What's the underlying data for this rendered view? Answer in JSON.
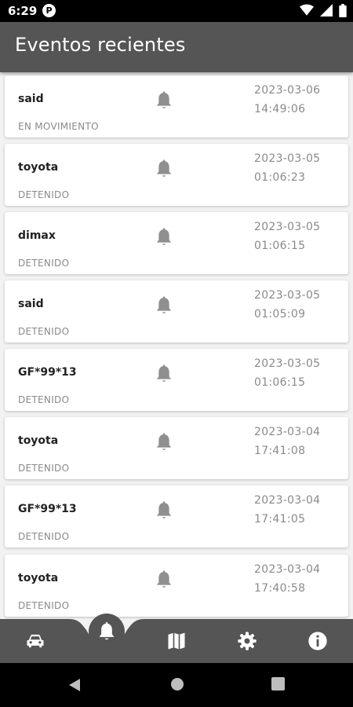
{
  "status_bar": {
    "time": "6:29",
    "app_icon_letter": "P"
  },
  "appbar": {
    "title": "Eventos recientes"
  },
  "events": [
    {
      "name": "said",
      "state": "EN MOVIMIENTO",
      "date": "2023-03-06",
      "time": "14:49:06"
    },
    {
      "name": "toyota",
      "state": "DETENIDO",
      "date": "2023-03-05",
      "time": "01:06:23"
    },
    {
      "name": "dimax",
      "state": "DETENIDO",
      "date": "2023-03-05",
      "time": "01:06:15"
    },
    {
      "name": "said",
      "state": "DETENIDO",
      "date": "2023-03-05",
      "time": "01:05:09"
    },
    {
      "name": "GF*99*13",
      "state": "DETENIDO",
      "date": "2023-03-05",
      "time": "01:06:15"
    },
    {
      "name": "toyota",
      "state": "DETENIDO",
      "date": "2023-03-04",
      "time": "17:41:08"
    },
    {
      "name": "GF*99*13",
      "state": "DETENIDO",
      "date": "2023-03-04",
      "time": "17:41:05"
    },
    {
      "name": "toyota",
      "state": "DETENIDO",
      "date": "2023-03-04",
      "time": "17:40:58"
    }
  ],
  "bottom_nav": {
    "items": [
      {
        "icon": "car-icon",
        "active": false
      },
      {
        "icon": "bell-icon",
        "active": true
      },
      {
        "icon": "map-icon",
        "active": false
      },
      {
        "icon": "gear-icon",
        "active": false
      },
      {
        "icon": "info-icon",
        "active": false
      }
    ]
  },
  "colors": {
    "appbar": "#555555",
    "background": "#f2f2f2",
    "card": "#ffffff",
    "muted_text": "#8a8a8a",
    "bell": "#8f8f8f"
  }
}
